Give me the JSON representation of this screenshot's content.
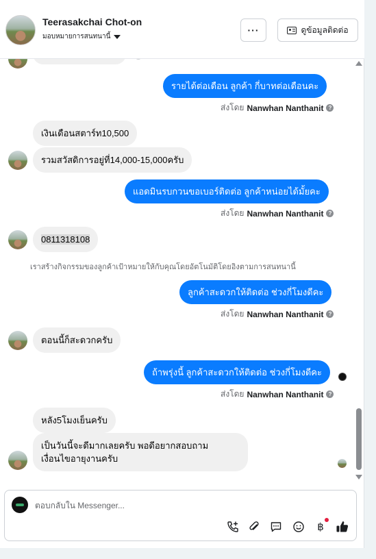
{
  "header": {
    "name": "Teerasakchai Chot-on",
    "subtitle": "มอบหมายการสนทนานี้",
    "more_label": "···",
    "contact_label": "ดูข้อมูลติดต่อ"
  },
  "messages": {
    "out1": "รายได้ต่อเดือน  ลูกค้า กี่บาทต่อเดือนคะ",
    "in1": "เงินเดือนสตาร์ท10,500",
    "in2": "รวมสวัสดิการอยู่ที่14,000-15,000ครับ",
    "out2": "แอดมินรบกวนขอเบอร์ติดต่อ ลูกค้าหน่อยได้มั้ยคะ",
    "in3": "0811318108",
    "system_note": "เราสร้างกิจกรรมของลูกค้าเป้าหมายให้กับคุณโดยอัตโนมัติโดยอิงตามการสนทนานี้",
    "out3": "ลูกค้าสะดวกให้ติดต่อ ช่วงกี่โมงดีคะ",
    "in4": "ตอนนี้ก็สะดวกครับ",
    "out4": "ถ้าพรุ่งนี้ ลูกค้าสะดวกให้ติดต่อ ช่วงกี่โมงดีคะ",
    "in5": "หลัง5โมงเย็นครับ",
    "in6_line1": "เป็นวันนี้จะดีมากเลยครับ พอดีอยากสอบถาม",
    "in6_line2": "เงื่อนไขอายุงานครับ"
  },
  "sent_by": {
    "prefix": "ส่งโดย",
    "name": "Nanwhan Nanthanit"
  },
  "composer": {
    "placeholder": "ตอบกลับใน Messenger...",
    "icons": [
      "add-call-icon",
      "attachment-icon",
      "saved-reply-icon",
      "emoji-icon",
      "payment-baht-icon",
      "like-icon"
    ]
  },
  "colors": {
    "outgoing_bubble": "#0a7cff",
    "incoming_bubble": "#f0f0f0",
    "notification_dot": "#e41e3f"
  }
}
